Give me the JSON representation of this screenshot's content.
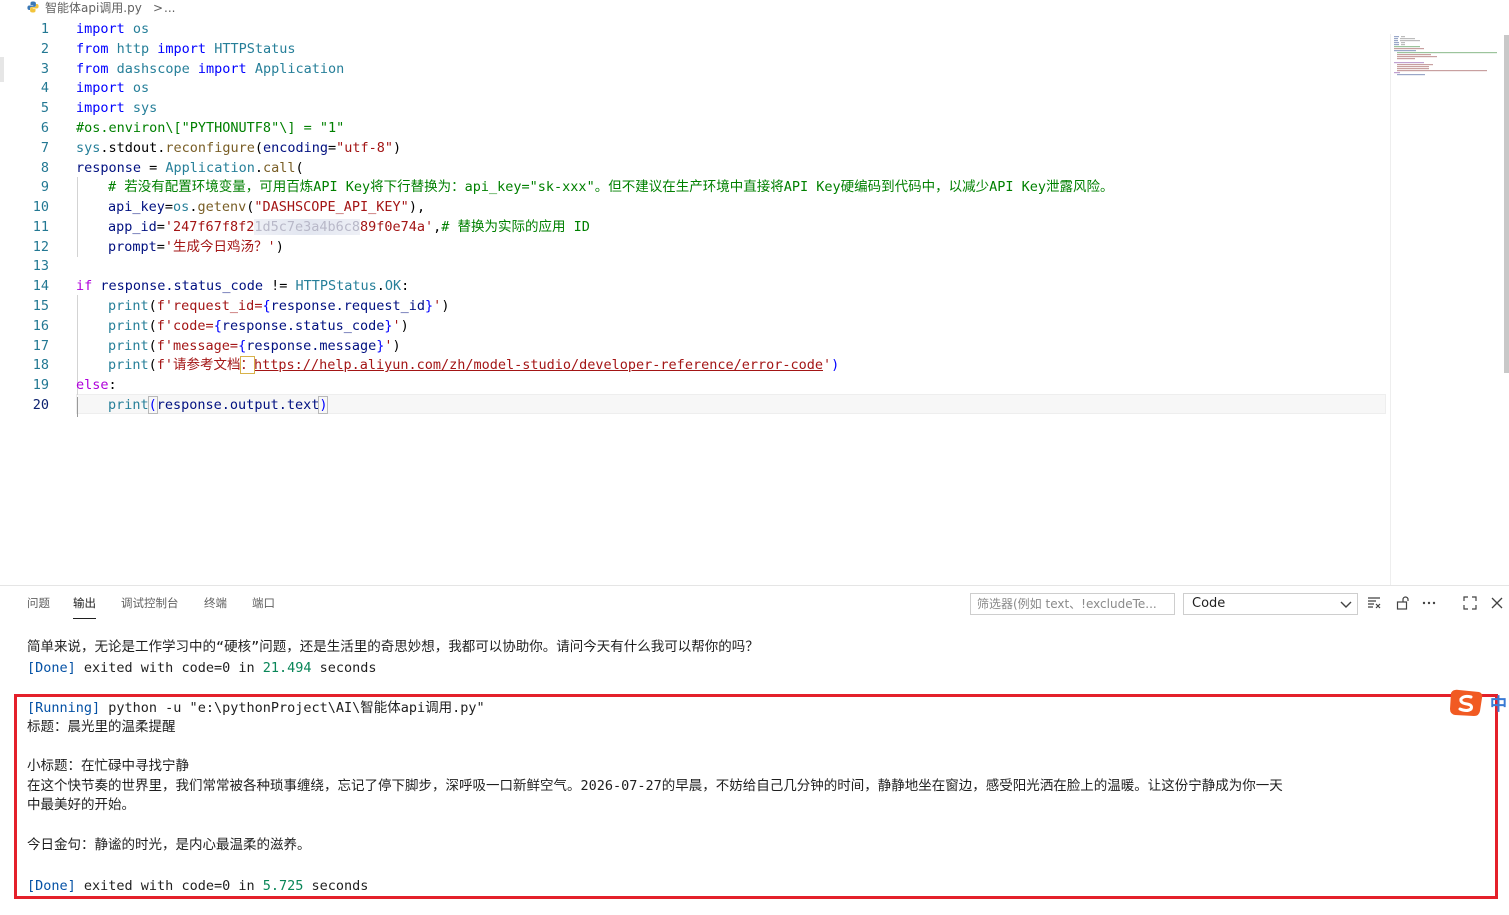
{
  "breadcrumb": {
    "file": "智能体api调用.py",
    "separator": ">",
    "more": "..."
  },
  "editor": {
    "active_line": 20,
    "line_numbers": [
      "1",
      "2",
      "3",
      "4",
      "5",
      "6",
      "7",
      "8",
      "9",
      "10",
      "11",
      "12",
      "13",
      "14",
      "15",
      "16",
      "17",
      "18",
      "19",
      "20"
    ]
  },
  "code": {
    "l1": [
      "import",
      " os"
    ],
    "l2": [
      "from",
      " http ",
      "import",
      " HTTPStatus"
    ],
    "l3": [
      "from",
      " dashscope ",
      "import",
      " Application"
    ],
    "l4": [
      "import",
      " os"
    ],
    "l5": [
      "import",
      " sys"
    ],
    "l6": "#os.environ\\[\"PYTHONUTF8\"\\] = \"1\"",
    "l7": [
      "sys",
      ".stdout.",
      "reconfigure",
      "(",
      "encoding",
      "=",
      "\"utf-8\"",
      ")"
    ],
    "l8": [
      "response",
      " = ",
      "Application",
      ".",
      "call",
      "("
    ],
    "l9": "# 若没有配置环境变量，可用百炼API Key将下行替换为：api_key=\"sk-xxx\"。但不建议在生产环境中直接将API Key硬编码到代码中，以减少API Key泄露风险。",
    "l10": [
      "api_key",
      "=",
      "os",
      ".",
      "getenv",
      "(",
      "\"DASHSCOPE_API_KEY\"",
      "),"
    ],
    "l11": [
      "app_id",
      "=",
      "'247f67f8f2",
      "1d5c7e3a4b6c8",
      "89f0e74a'",
      ",",
      "# 替换为实际的应用 ID"
    ],
    "l12": [
      "prompt",
      "=",
      "'生成今日鸡汤？'",
      ")"
    ],
    "l14": [
      "if",
      " response.",
      "status_code",
      " != ",
      "HTTPStatus",
      ".",
      "OK",
      ":"
    ],
    "l15": [
      "print",
      "(",
      "f'request_id=",
      "{",
      "response.request_id",
      "}",
      "'",
      ")"
    ],
    "l16": [
      "print",
      "(",
      "f'code=",
      "{",
      "response.status_code",
      "}",
      "'",
      ")"
    ],
    "l17": [
      "print",
      "(",
      "f'message=",
      "{",
      "response.message",
      "}",
      "'",
      ")"
    ],
    "l18": [
      "print",
      "(",
      "f'请参考文档",
      "：",
      "https://help.aliyun.com/zh/model-studio/developer-reference/error-code",
      "'",
      ")"
    ],
    "l19": [
      "else",
      ":"
    ],
    "l20": [
      "print",
      "(",
      "response.output.text",
      ")"
    ]
  },
  "panel": {
    "tabs": [
      "问题",
      "输出",
      "调试控制台",
      "终端",
      "端口"
    ],
    "active_tab": "输出",
    "filter_placeholder": "筛选器(例如 text、!excludeTe...",
    "channel": "Code",
    "output": {
      "prev_line": "简单来说，无论是工作学习中的“硬核”问题，还是生活里的奇思妙想，我都可以协助你。请问今天有什么我可以帮你的吗？",
      "prev_done_tag": "[Done]",
      "prev_done_text1": " exited with ",
      "prev_done_code": "code=0",
      "prev_done_text2": " in ",
      "prev_done_secs": "21.494",
      "prev_done_text3": " seconds",
      "running_tag": "[Running]",
      "running_cmd": " python -u \"e:\\pythonProject\\AI\\智能体api调用.py\"",
      "title": "标题：晨光里的温柔提醒",
      "subtitle": "小标题：在忙碌中寻找宁静",
      "para1": "在这个快节奏的世界里，我们常常被各种琐事缠绕，忘记了停下脚步，深呼吸一口新鲜空气。2026-07-27的早晨，不妨给自己几分钟的时间，静静地坐在窗边，感受阳光洒在脸上的温暖。让这份宁静成为你一天",
      "para2": "中最美好的开始。",
      "quote": "今日金句：静谧的时光，是内心最温柔的滋养。",
      "done_tag": "[Done]",
      "done_text1": " exited with ",
      "done_code": "code=0",
      "done_text2": " in ",
      "done_secs": "5.725",
      "done_text3": " seconds"
    }
  },
  "ime": {
    "label": "中"
  },
  "colors": {
    "highlight_box": "#e4202a",
    "keyword": "#0000ff",
    "control": "#af00db",
    "string": "#a31515",
    "comment": "#008000"
  }
}
